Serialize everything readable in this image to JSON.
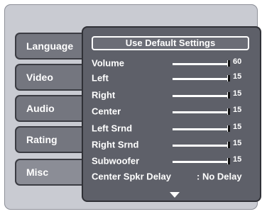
{
  "tabs": [
    {
      "label": "Language",
      "active": false
    },
    {
      "label": "Video",
      "active": false
    },
    {
      "label": "Audio",
      "active": false
    },
    {
      "label": "Rating",
      "active": false
    },
    {
      "label": "Misc",
      "active": true
    }
  ],
  "panel": {
    "default_button": "Use Default Settings",
    "settings": [
      {
        "label": "Volume",
        "value": "60"
      },
      {
        "label": "Left",
        "value": "15"
      },
      {
        "label": "Right",
        "value": "15"
      },
      {
        "label": "Center",
        "value": "15"
      },
      {
        "label": "Left Srnd",
        "value": "15"
      },
      {
        "label": "Right Srnd",
        "value": "15"
      },
      {
        "label": "Subwoofer",
        "value": "15"
      }
    ],
    "delay": {
      "label": "Center Spkr Delay",
      "value": ": No Delay"
    },
    "scroll_icon": "down-arrow-icon"
  },
  "colors": {
    "frame": "#c9cbd2",
    "tab": "#74767f",
    "panel": "#5e6069",
    "text": "#ffffff"
  }
}
